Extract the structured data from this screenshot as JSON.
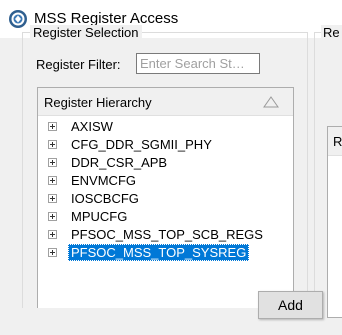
{
  "window": {
    "title": "MSS Register Access",
    "icon": "app-logo-icon"
  },
  "register_selection": {
    "group_title": "Register Selection",
    "filter_label": "Register Filter:",
    "filter_value": "",
    "filter_placeholder": "Enter Search St…",
    "tree_header": "Register Hierarchy",
    "tree_items": [
      {
        "label": "AXISW",
        "selected": false
      },
      {
        "label": "CFG_DDR_SGMII_PHY",
        "selected": false
      },
      {
        "label": "DDR_CSR_APB",
        "selected": false
      },
      {
        "label": "ENVMCFG",
        "selected": false
      },
      {
        "label": "IOSCBCFG",
        "selected": false
      },
      {
        "label": "MPUCFG",
        "selected": false
      },
      {
        "label": "PFSOC_MSS_TOP_SCB_REGS",
        "selected": false
      },
      {
        "label": "PFSOC_MSS_TOP_SYSREG",
        "selected": true
      }
    ]
  },
  "right_group": {
    "group_title": "Re",
    "panel_header": "R"
  },
  "add_button": {
    "label": "Add"
  },
  "colors": {
    "selection": "#0078d7",
    "background": "#f0f0f0"
  }
}
